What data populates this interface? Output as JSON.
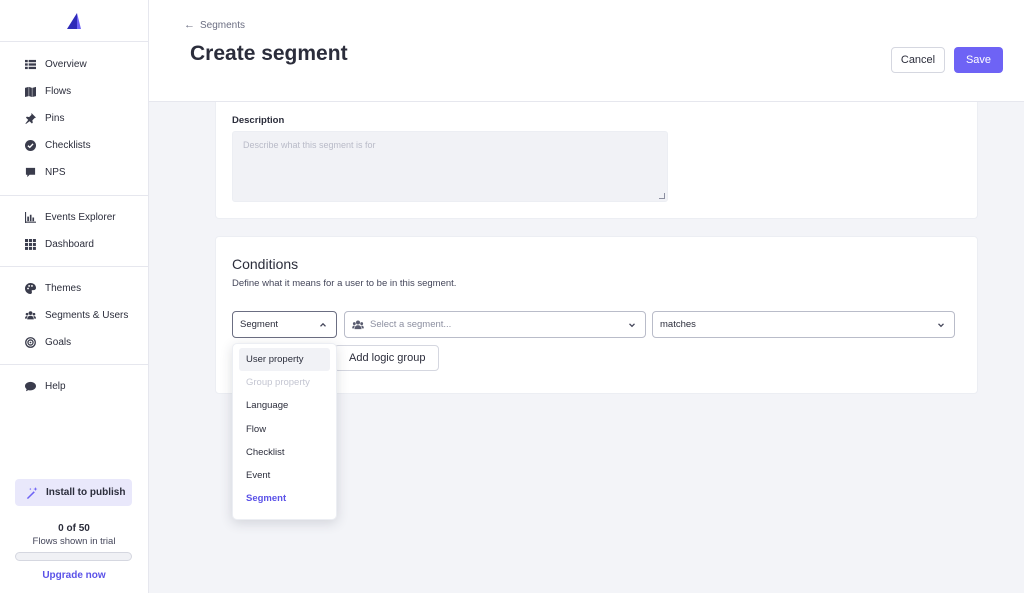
{
  "sidebar": {
    "group1": [
      {
        "label": "Overview",
        "icon": "list-icon"
      },
      {
        "label": "Flows",
        "icon": "map-icon"
      },
      {
        "label": "Pins",
        "icon": "pin-icon"
      },
      {
        "label": "Checklists",
        "icon": "check-circle-icon"
      },
      {
        "label": "NPS",
        "icon": "comment-icon"
      }
    ],
    "group2": [
      {
        "label": "Events Explorer",
        "icon": "chart-icon"
      },
      {
        "label": "Dashboard",
        "icon": "grid-icon"
      }
    ],
    "group3": [
      {
        "label": "Themes",
        "icon": "palette-icon"
      },
      {
        "label": "Segments & Users",
        "icon": "users-icon"
      },
      {
        "label": "Goals",
        "icon": "target-icon"
      }
    ],
    "group4": [
      {
        "label": "Help",
        "icon": "chat-icon"
      }
    ],
    "install_label": "Install to publish",
    "trial_count": "0 of 50",
    "trial_text": "Flows shown in trial",
    "trial_progress": 0,
    "upgrade_label": "Upgrade now"
  },
  "header": {
    "breadcrumb": "Segments",
    "title": "Create segment",
    "cancel_label": "Cancel",
    "save_label": "Save"
  },
  "description": {
    "label": "Description",
    "placeholder": "Describe what this segment is for"
  },
  "conditions": {
    "title": "Conditions",
    "subtitle": "Define what it means for a user to be in this segment.",
    "type_value": "Segment",
    "segment_placeholder": "Select a segment...",
    "match_value": "matches",
    "add_group_label": "Add logic group"
  },
  "dropdown": {
    "items": [
      {
        "label": "User property",
        "state": "hover"
      },
      {
        "label": "Group property",
        "state": "disabled"
      },
      {
        "label": "Language",
        "state": "normal"
      },
      {
        "label": "Flow",
        "state": "normal"
      },
      {
        "label": "Checklist",
        "state": "normal"
      },
      {
        "label": "Event",
        "state": "normal"
      },
      {
        "label": "Segment",
        "state": "selected"
      }
    ]
  },
  "colors": {
    "accent": "#6e63f5",
    "link": "#5b52e8"
  }
}
